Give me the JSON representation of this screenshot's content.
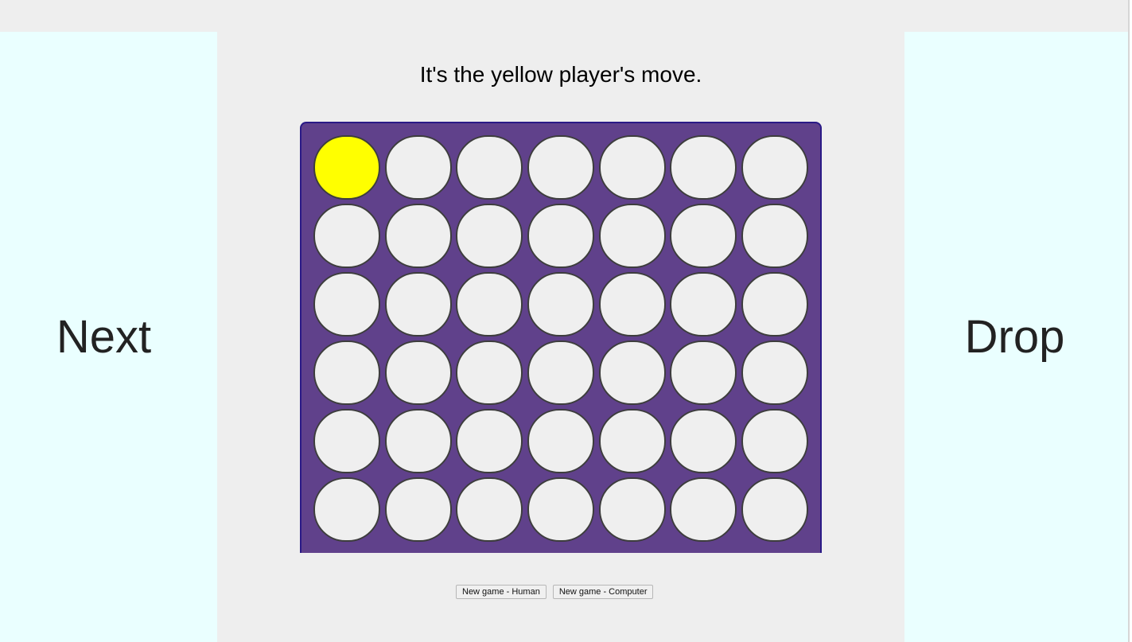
{
  "status_text": "It's the yellow player's move.",
  "left_panel": {
    "label": "Next"
  },
  "right_panel": {
    "label": "Drop"
  },
  "board": {
    "columns": 7,
    "rows": 6,
    "colors": {
      "board": "#60418b",
      "board_border": "#2a1a86",
      "empty": "#efefef",
      "yellow": "#ffff00"
    },
    "cells": [
      [
        "yellow",
        "empty",
        "empty",
        "empty",
        "empty",
        "empty",
        "empty"
      ],
      [
        "empty",
        "empty",
        "empty",
        "empty",
        "empty",
        "empty",
        "empty"
      ],
      [
        "empty",
        "empty",
        "empty",
        "empty",
        "empty",
        "empty",
        "empty"
      ],
      [
        "empty",
        "empty",
        "empty",
        "empty",
        "empty",
        "empty",
        "empty"
      ],
      [
        "empty",
        "empty",
        "empty",
        "empty",
        "empty",
        "empty",
        "empty"
      ],
      [
        "empty",
        "empty",
        "empty",
        "empty",
        "empty",
        "empty",
        "empty"
      ]
    ]
  },
  "buttons": {
    "human": "New game - Human",
    "computer": "New game - Computer"
  },
  "colors": {
    "side_panel": "#eaffff",
    "page_background": "#eeeeee"
  }
}
